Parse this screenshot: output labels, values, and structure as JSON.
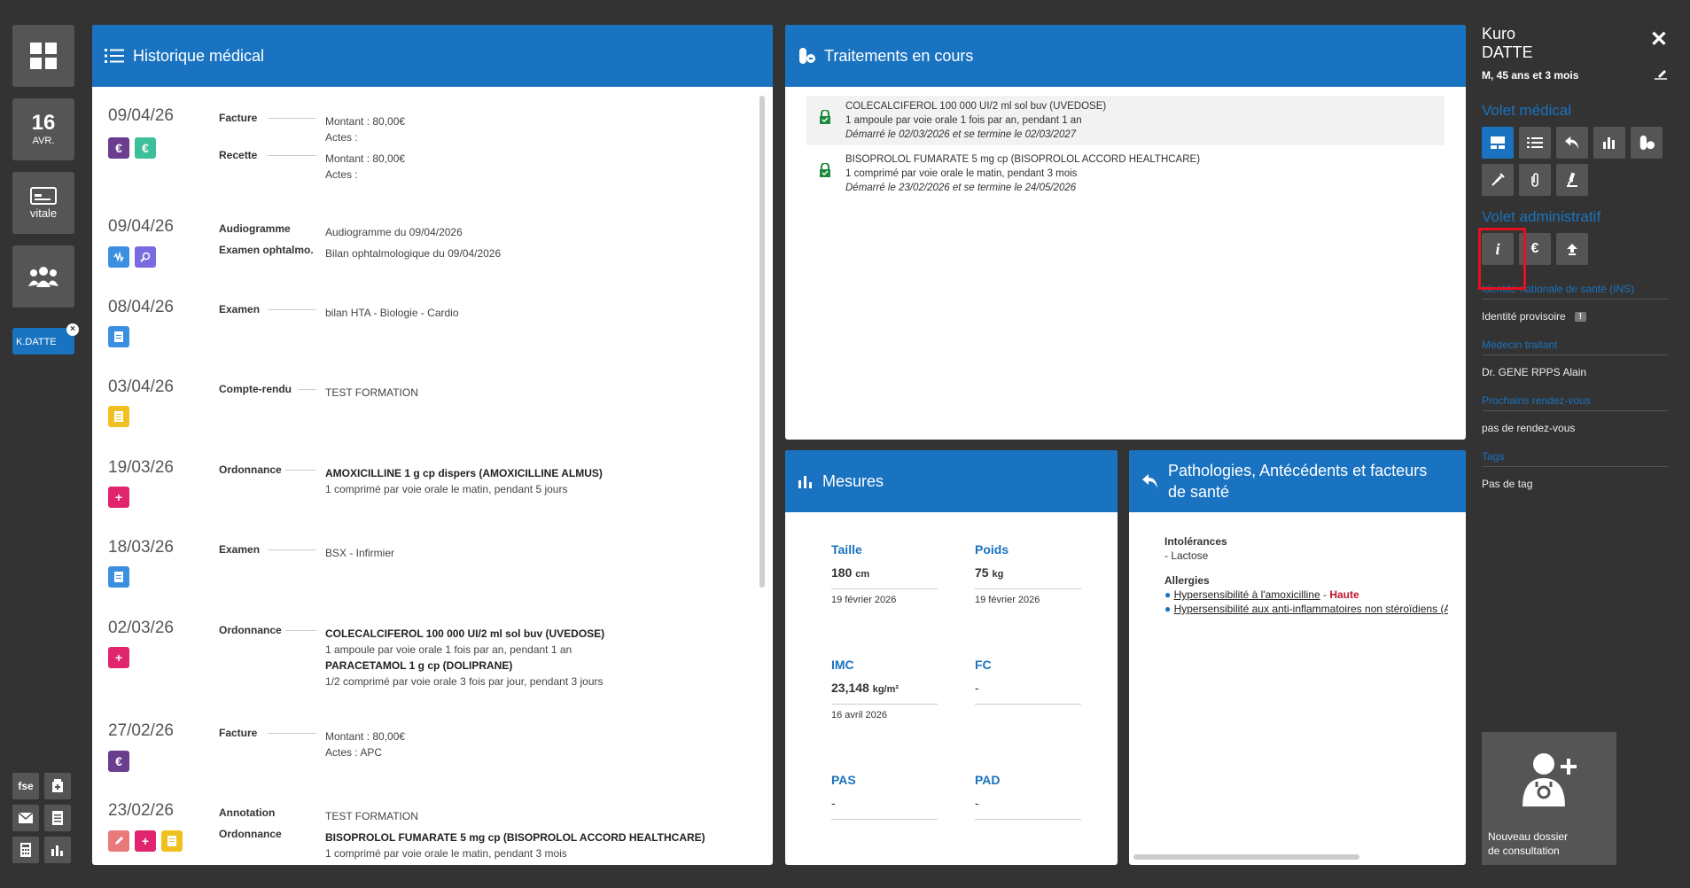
{
  "rail": {
    "date_day": "16",
    "date_month": "AVR.",
    "vitale": "vitale",
    "patient_tab": "K.DATTE",
    "patient_close": "×",
    "tools": [
      "fse",
      "",
      "",
      "",
      "",
      ""
    ]
  },
  "history": {
    "title": "Historique médical",
    "entries": [
      {
        "date": "09/04/26",
        "rows": [
          {
            "type": "Facture",
            "lines": [
              "Montant : 80,00€",
              "Actes :"
            ]
          },
          {
            "type": "Recette",
            "lines": [
              "Montant : 80,00€",
              "Actes :"
            ]
          }
        ]
      },
      {
        "date": "09/04/26",
        "rows": [
          {
            "type": "Audiogramme",
            "lines": [
              "Audiogramme du 09/04/2026"
            ]
          },
          {
            "type": "Examen ophtalmo.",
            "lines": [
              "Bilan ophtalmologique du 09/04/2026"
            ]
          }
        ]
      },
      {
        "date": "08/04/26",
        "rows": [
          {
            "type": "Examen",
            "lines": [
              "bilan HTA - Biologie - Cardio"
            ]
          }
        ]
      },
      {
        "date": "03/04/26",
        "rows": [
          {
            "type": "Compte-rendu",
            "lines": [
              "TEST FORMATION"
            ]
          }
        ]
      },
      {
        "date": "19/03/26",
        "rows": [
          {
            "type": "Ordonnance",
            "lines": [
              "AMOXICILLINE 1 g cp dispers (AMOXICILLINE ALMUS)",
              "1 comprimé par voie orale le matin, pendant 5 jours"
            ]
          }
        ]
      },
      {
        "date": "18/03/26",
        "rows": [
          {
            "type": "Examen",
            "lines": [
              "BSX - Infirmier"
            ]
          }
        ]
      },
      {
        "date": "02/03/26",
        "rows": [
          {
            "type": "Ordonnance",
            "lines": [
              "COLECALCIFEROL 100 000 UI/2 ml sol buv (UVEDOSE)",
              "1 ampoule par voie orale 1 fois par an, pendant 1 an",
              "PARACETAMOL 1 g cp (DOLIPRANE)",
              "1/2 comprimé par voie orale 3 fois par jour, pendant 3 jours"
            ]
          }
        ]
      },
      {
        "date": "27/02/26",
        "rows": [
          {
            "type": "Facture",
            "lines": [
              "Montant : 80,00€",
              "Actes : APC"
            ]
          }
        ]
      },
      {
        "date": "23/02/26",
        "rows": [
          {
            "type": "Annotation",
            "lines": [
              "TEST FORMATION"
            ]
          },
          {
            "type": "Ordonnance",
            "lines": [
              "BISOPROLOL FUMARATE 5 mg cp (BISOPROLOL ACCORD HEALTHCARE)",
              "1 comprimé par voie orale le matin, pendant 3 mois"
            ]
          }
        ]
      }
    ],
    "badge_euro": "€",
    "badge_plus": "+"
  },
  "treatments": {
    "title": "Traitements en cours",
    "items": [
      {
        "name": "COLECALCIFEROL 100 000 UI/2 ml sol buv (UVEDOSE)",
        "posology": "1 ampoule par voie orale 1 fois par an, pendant 1 an",
        "period": "Démarré le 02/03/2026 et se termine le 02/03/2027"
      },
      {
        "name": "BISOPROLOL FUMARATE 5 mg cp (BISOPROLOL ACCORD HEALTHCARE)",
        "posology": "1 comprimé par voie orale le matin, pendant 3 mois",
        "period": "Démarré le 23/02/2026 et se termine le 24/05/2026"
      }
    ]
  },
  "measures": {
    "title": "Mesures",
    "items": [
      {
        "label": "Taille",
        "value": "180",
        "unit": "cm",
        "date": "19 février 2026"
      },
      {
        "label": "Poids",
        "value": "75",
        "unit": "kg",
        "date": "19 février 2026"
      },
      {
        "label": "IMC",
        "value": "23,148",
        "unit": "kg/m²",
        "date": "16 avril 2026"
      },
      {
        "label": "FC",
        "value": "-",
        "unit": "",
        "date": ""
      },
      {
        "label": "PAS",
        "value": "-",
        "unit": "",
        "date": ""
      },
      {
        "label": "PAD",
        "value": "-",
        "unit": "",
        "date": ""
      }
    ]
  },
  "pathologies": {
    "title_line1": "Pathologies, Antécédents et facteurs",
    "title_line2": "de santé",
    "intolerances_label": "Intolérances",
    "intolerance": "-  Lactose",
    "allergies_label": "Allergies",
    "allergy1": "Hypersensibilité à l'amoxicilline",
    "allergy1_sep": "-",
    "allergy1_level": "Haute",
    "allergy2": "Hypersensibilité aux anti-inflammatoires non stéroïdiens (A"
  },
  "side": {
    "first_name": "Kuro",
    "last_name": "DATTE",
    "demographics": "M, 45 ans et 3 mois",
    "close": "✕",
    "volet_medical": "Volet médical",
    "volet_admin": "Volet administratif",
    "ins_label": "Identité nationale de santé (INS)",
    "ins_value": "Identité provisoire",
    "ins_flag": "!",
    "doctor_label": "Médecin traitant",
    "doctor_value": "Dr. GENE RPPS Alain",
    "rdv_label": "Prochains rendez-vous",
    "rdv_value": "pas de rendez-vous",
    "tags_label": "Tags",
    "tags_value": "Pas de tag",
    "admin_euro": "€",
    "admin_info": "i",
    "new_folder_line1": "Nouveau dossier",
    "new_folder_line2": "de consultation"
  },
  "colors": {
    "accent": "#1a73c0",
    "panel_bg": "#333333",
    "tile": "#555555",
    "highlight": "#e3121e",
    "euro_purple": "#6a3d8f",
    "euro_green": "#3cbf9a",
    "plus_pink": "#e0246d",
    "doc_blue": "#3b8fe0",
    "note_yellow": "#f0c020"
  }
}
